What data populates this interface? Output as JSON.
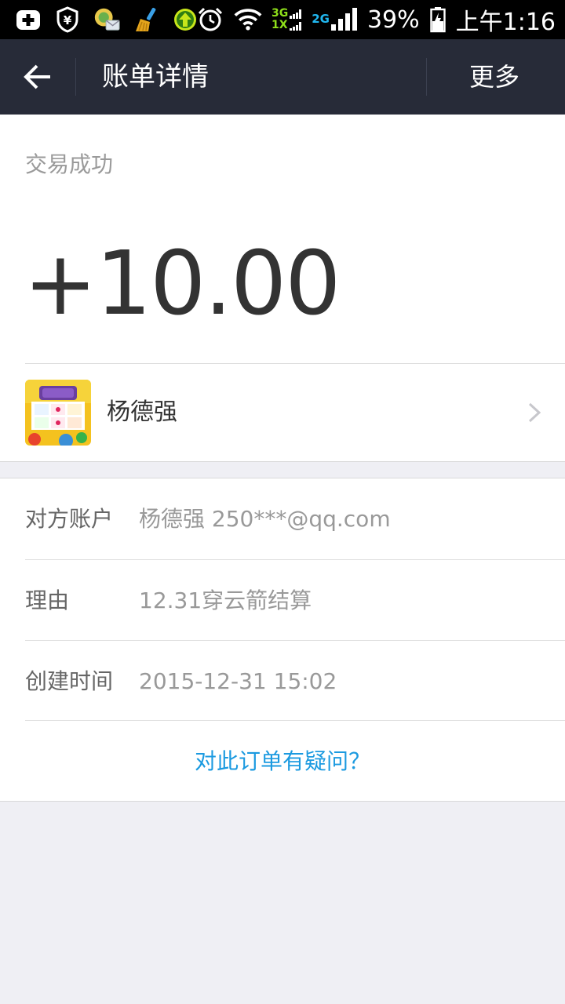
{
  "status_bar": {
    "icons": [
      "add-notification-icon",
      "shield-yen-icon",
      "message-app-icon",
      "broom-cleaner-icon",
      "upload-arrow-icon",
      "alarm-icon",
      "wifi-icon",
      "signal-3g-1x-icon",
      "signal-2g-icon",
      "battery-charging-icon"
    ],
    "net_3g": "3G",
    "net_1x": "1X",
    "net_2g": "2G",
    "battery": "39%",
    "time": "上午1:16"
  },
  "nav": {
    "title": "账单详情",
    "more": "更多"
  },
  "summary": {
    "status": "交易成功",
    "amount": "+10.00",
    "payer_name": "杨德强"
  },
  "details": {
    "rows": [
      {
        "label": "对方账户",
        "value": "杨德强 250***@qq.com"
      },
      {
        "label": "理由",
        "value": "12.31穿云箭结算"
      },
      {
        "label": "创建时间",
        "value": "2015-12-31 15:02"
      }
    ],
    "question": "对此订单有疑问？"
  },
  "colors": {
    "nav_bg": "#272b38",
    "link": "#1b9ae0",
    "page_bg": "#efeff4"
  }
}
